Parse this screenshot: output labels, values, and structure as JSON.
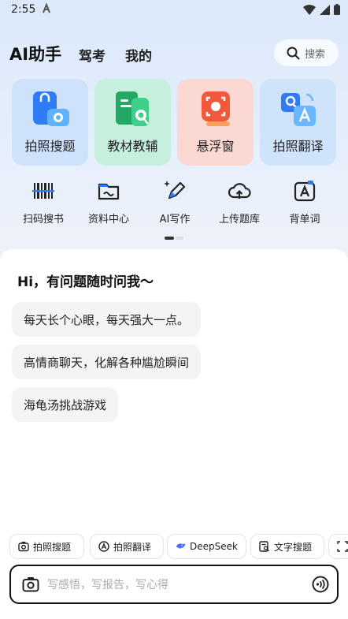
{
  "status": {
    "time": "2:55"
  },
  "header": {
    "title": "AI助手",
    "tabs": [
      "驾考",
      "我的"
    ],
    "search_label": "搜索"
  },
  "cards": [
    {
      "label": "拍照搜题",
      "icon": "photo-search-icon"
    },
    {
      "label": "教材教辅",
      "icon": "textbook-icon"
    },
    {
      "label": "悬浮窗",
      "icon": "floating-window-icon"
    },
    {
      "label": "拍照翻译",
      "icon": "photo-translate-icon"
    }
  ],
  "tools": [
    {
      "label": "扫码搜书",
      "icon": "barcode-icon"
    },
    {
      "label": "资料中心",
      "icon": "folder-icon"
    },
    {
      "label": "AI写作",
      "icon": "pen-sparkle-icon"
    },
    {
      "label": "上传题库",
      "icon": "cloud-upload-icon"
    },
    {
      "label": "背单词",
      "icon": "word-book-icon"
    }
  ],
  "chat": {
    "greeting": "Hi，有问题随时问我～",
    "suggestions": [
      "每天长个心眼，每天强大一点。",
      "高情商聊天，化解各种尴尬瞬间",
      "海龟汤挑战游戏"
    ]
  },
  "chips": [
    {
      "label": "拍照搜题",
      "icon": "camera-icon"
    },
    {
      "label": "拍照翻译",
      "icon": "translate-icon"
    },
    {
      "label": "DeepSeek",
      "icon": "deepseek-icon"
    },
    {
      "label": "文字搜题",
      "icon": "text-search-icon"
    },
    {
      "label": "",
      "icon": "scan-icon"
    }
  ],
  "input": {
    "placeholder": "写感悟，写报告，写心得"
  },
  "colors": {
    "accent_blue": "#2f7cf6",
    "accent_green": "#26b36c",
    "accent_orange": "#f2583a"
  }
}
